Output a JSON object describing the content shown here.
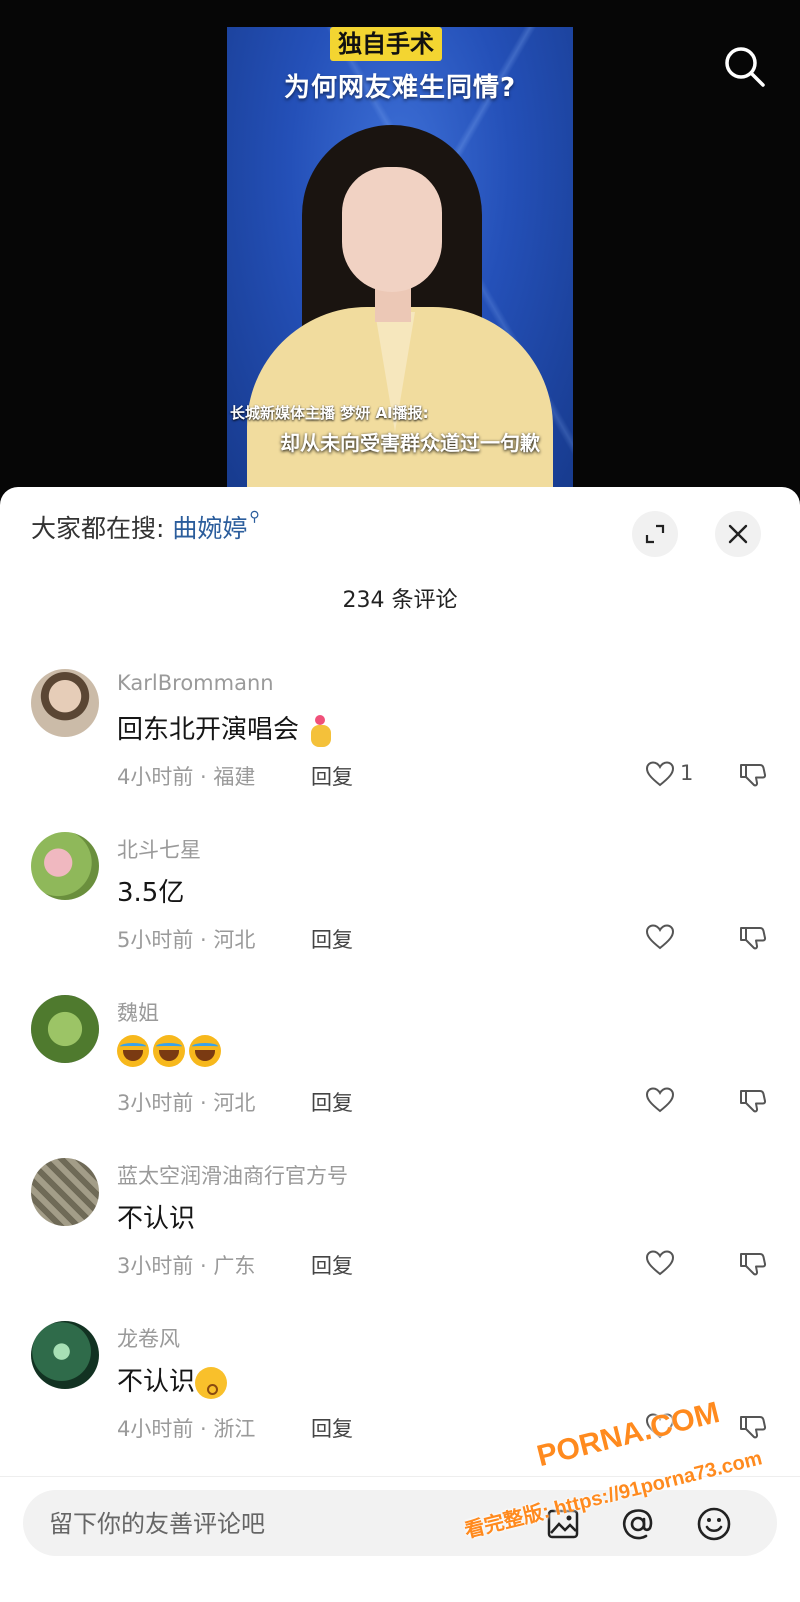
{
  "video": {
    "tag": "独自手术",
    "headline": "为何网友难生同情?",
    "caption_small": "长城新媒体主播 梦妍 AI播报:",
    "caption_big": "却从未向受害群众道过一句歉"
  },
  "sheet": {
    "hot_search_prefix": "大家都在搜:",
    "hot_search_keyword": "曲婉婷",
    "comment_count": "234 条评论"
  },
  "comments": [
    {
      "username": "KarlBrommann",
      "content": "回东北开演唱会",
      "emoji": "heart-hand-emoji",
      "time": "4小时前 · 福建",
      "reply": "回复",
      "likes": "1",
      "avatar_color": "#c9b6a3"
    },
    {
      "username": "北斗七星",
      "content": "3.5亿",
      "time": "5小时前 · 河北",
      "reply": "回复",
      "likes": "",
      "avatar_color": "#8fb85a"
    },
    {
      "username": "魏姐",
      "content": "",
      "emoji": "laughing-crying-emoji",
      "time": "3小时前 · 河北",
      "reply": "回复",
      "likes": "",
      "avatar_color": "#5f8a3a"
    },
    {
      "username": "蓝太空润滑油商行官方号",
      "content": "不认识",
      "time": "3小时前 · 广东",
      "reply": "回复",
      "likes": "",
      "avatar_color": "#8f8b7a"
    },
    {
      "username": "龙卷风",
      "content": "不认识",
      "emoji": "kissing-emoji",
      "time": "4小时前 · 浙江",
      "reply": "回复",
      "likes": "",
      "avatar_color": "#2f6b4a"
    }
  ],
  "input": {
    "placeholder": "留下你的友善评论吧"
  },
  "watermark": {
    "brand": "PORNA.COM",
    "url": "看完整版: https://91porna73.com"
  },
  "colors": {
    "keyword": "#2b5d9c",
    "watermark": "#ff8a1e",
    "video_bg": "#2450b8",
    "tag_bg": "#f3d531"
  }
}
